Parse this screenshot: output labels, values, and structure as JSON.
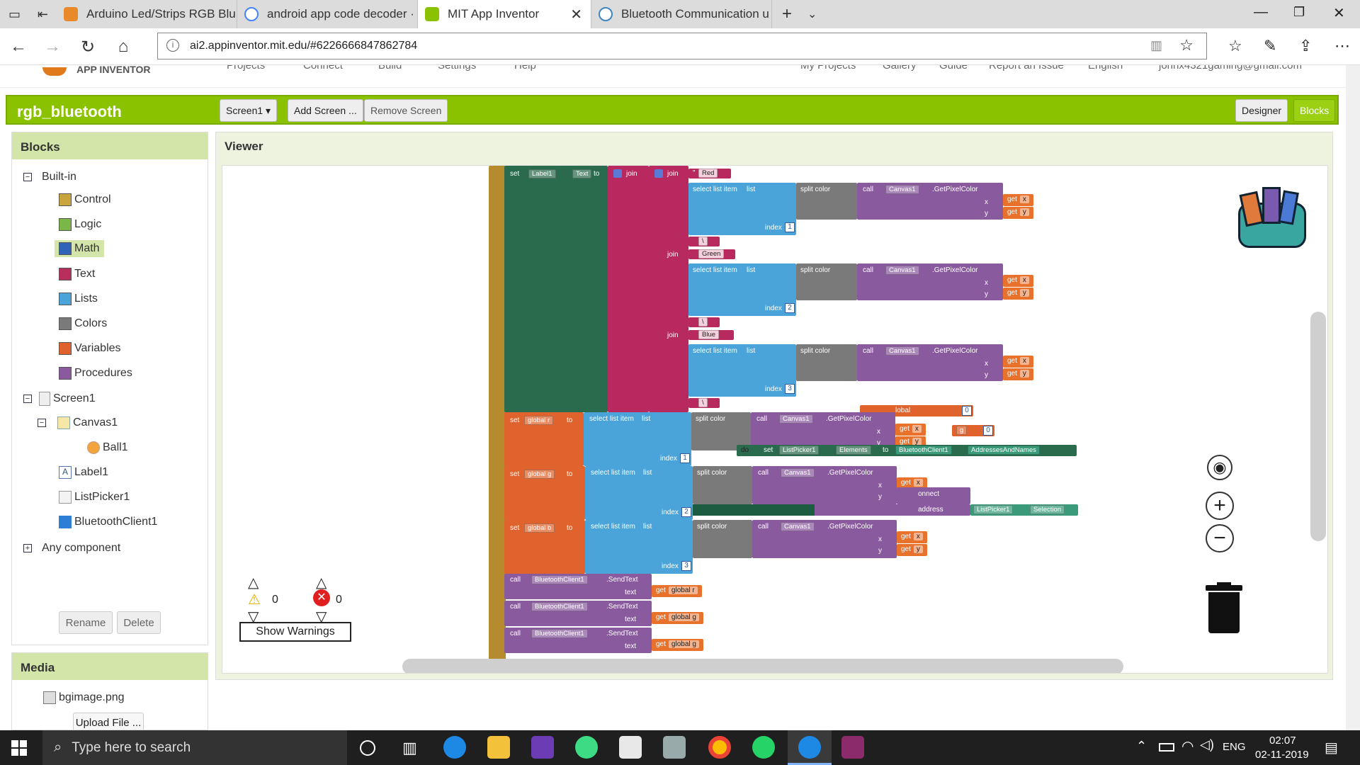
{
  "browser": {
    "tabs": [
      {
        "label": "Arduino Led/Strips RGB Blu",
        "color": "#e88a2a"
      },
      {
        "label": "android app code decoder ·",
        "color": "#4285f4"
      },
      {
        "label": "MIT App Inventor",
        "color": "#8bc200"
      },
      {
        "label": "Bluetooth Communication u",
        "color": "#3d85c6"
      }
    ],
    "url": "ai2.appinventor.mit.edu/#6226666847862784"
  },
  "topnav": {
    "logo": "APP INVENTOR",
    "items": [
      "Projects",
      "Connect",
      "Build",
      "Settings",
      "Help"
    ],
    "right_items": [
      "My Projects",
      "Gallery",
      "Guide",
      "Report an Issue",
      "English",
      "johnx4321gaming@gmail.com"
    ]
  },
  "project": {
    "name": "rgb_bluetooth",
    "screen_select": "Screen1 ▾",
    "add_screen": "Add Screen ...",
    "remove_screen": "Remove Screen",
    "designer": "Designer",
    "blocks": "Blocks"
  },
  "blocks_panel": {
    "title": "Blocks",
    "builtin": "Built-in",
    "categories": [
      {
        "label": "Control",
        "color": "#c9a53c"
      },
      {
        "label": "Logic",
        "color": "#7ab648"
      },
      {
        "label": "Math",
        "color": "#2e63b8"
      },
      {
        "label": "Text",
        "color": "#b82e5c"
      },
      {
        "label": "Lists",
        "color": "#4aa4da"
      },
      {
        "label": "Colors",
        "color": "#7a7a7a"
      },
      {
        "label": "Variables",
        "color": "#e0622c"
      },
      {
        "label": "Procedures",
        "color": "#8a5a9e"
      }
    ],
    "screen": "Screen1",
    "components": [
      "Canvas1",
      "Ball1",
      "Label1",
      "ListPicker1",
      "BluetoothClient1"
    ],
    "any_component": "Any component",
    "rename": "Rename",
    "delete": "Delete"
  },
  "media": {
    "title": "Media",
    "file": "bgimage.png",
    "upload": "Upload File ..."
  },
  "viewer": {
    "title": "Viewer",
    "warnings_count": "0",
    "errors_count": "0",
    "show_warnings": "Show Warnings"
  },
  "code": {
    "set": "set",
    "to": "to",
    "join": "join",
    "call": "call",
    "select_list_item": "select list item",
    "list": "list",
    "index": "index",
    "split_color": "split color",
    "get_pixel_color": ".GetPixelColor",
    "label1": "Label1",
    "text_prop": "Text",
    "canvas1": "Canvas1",
    "x": "x",
    "y": "y",
    "get": "get",
    "str_red": "Red",
    "str_green": "Green",
    "str_blue": "Blue",
    "str_sep": "\\",
    "idx1": "1",
    "idx2": "2",
    "idx3": "3",
    "global_r": "global r",
    "global_g": "global g",
    "global_b": "global b",
    "bt_client": "BluetoothClient1",
    "send_text": ".SendText",
    "text": "text",
    "global_label": "lobal",
    "g_to": "g",
    "zero": "0",
    "do": "do",
    "listpicker1": "ListPicker1",
    "elements": "Elements",
    "addresses": "AddressesAndNames",
    "connect": "onnect",
    "address": "address",
    "selection": "Selection"
  },
  "taskbar": {
    "search": "Type here to search",
    "lang": "ENG",
    "time": "02:07",
    "date": "02-11-2019"
  }
}
